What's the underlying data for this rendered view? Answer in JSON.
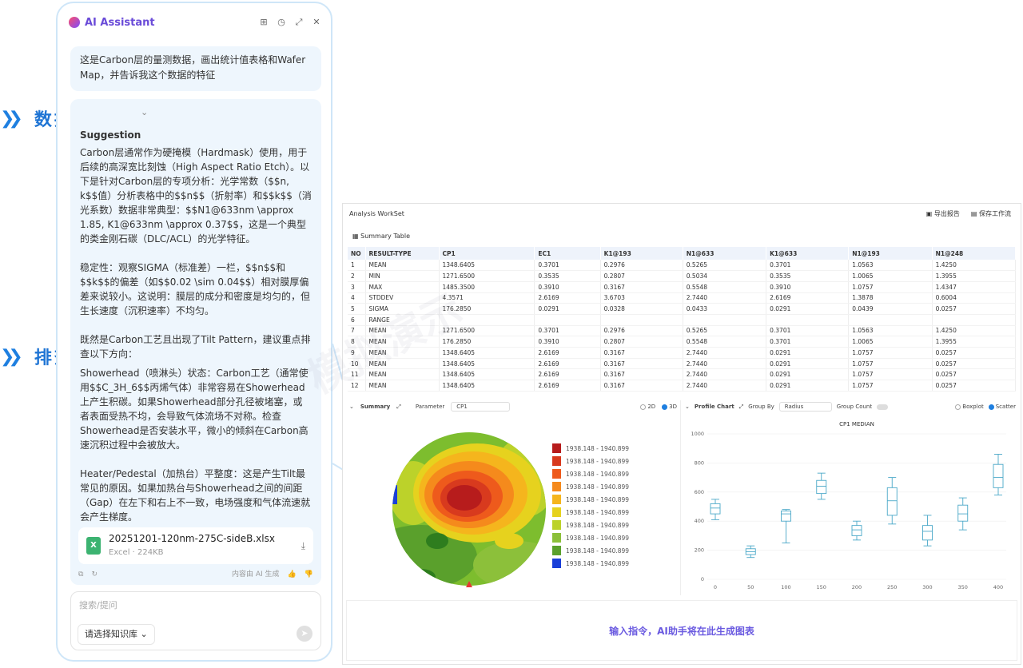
{
  "chat": {
    "brand": "AI Assistant",
    "user_message": "这是Carbon层的量测数据，画出统计值表格和Wafer Map，并告诉我这个数据的特征",
    "suggestion_label": "Suggestion",
    "paragraphs": [
      "Carbon层通常作为硬掩模（Hardmask）使用，用于后续的高深宽比刻蚀（High Aspect Ratio Etch）。以下是针对Carbon层的专项分析：光学常数（$$n, k$$值）分析表格中的$$n$$（折射率）和$$k$$（消光系数）数据非常典型：$$N1@633nm \\approx 1.85, K1@633nm \\approx 0.37$$，这是一个典型的类金刚石碳（DLC/ACL）的光学特征。",
      "稳定性：观察SIGMA（标准差）一栏，$$n$$和$$k$$的偏差（如$$0.02 \\sim 0.04$$）相对膜厚偏差来说较小。这说明：膜层的成分和密度是均匀的，但生长速度（沉积速率）不均匀。",
      "既然是Carbon工艺且出现了Tilt Pattern，建议重点排查以下方向：",
      "Showerhead（喷淋头）状态：Carbon工艺（通常使用$$C_3H_6$$丙烯气体）非常容易在Showerhead上产生积碳。如果Showerhead部分孔径被堵塞，或者表面受热不均，会导致气体流场不对称。检查Showerhead是否安装水平，微小的倾斜在Carbon高速沉积过程中会被放大。",
      "Heater/Pedestal（加热台）平整度：这是产生Tilt最常见的原因。如果加热台与Showerhead之间的间距（Gap）在左下和右上不一致，电场强度和气体流速就会产生梯度。"
    ],
    "file": {
      "name": "20251201-120nm-275C-sideB.xlsx",
      "meta": "Excel · 224KB",
      "badge": "X"
    },
    "foot_note": "内容由 AI 生成",
    "input_placeholder": "搜索/提问",
    "kb_select": "请选择知识库 ⌄"
  },
  "callouts": {
    "first": "数据解读",
    "second": "排查建议"
  },
  "workset": {
    "title": "Analysis WorkSet",
    "export_label": "导出报告",
    "save_label": "保存工作流",
    "table_title": "Summary Table",
    "columns": [
      "NO",
      "RESULT-TYPE",
      "CP1",
      "EC1",
      "K1@193",
      "N1@633",
      "K1@633",
      "N1@193",
      "N1@248"
    ],
    "rows": [
      [
        "1",
        "MEAN",
        "1348.6405",
        "0.3701",
        "0.2976",
        "0.5265",
        "0.3701",
        "1.0563",
        "1.4250"
      ],
      [
        "2",
        "MIN",
        "1271.6500",
        "0.3535",
        "0.2807",
        "0.5034",
        "0.3535",
        "1.0065",
        "1.3955"
      ],
      [
        "3",
        "MAX",
        "1485.3500",
        "0.3910",
        "0.3167",
        "0.5548",
        "0.3910",
        "1.0757",
        "1.4347"
      ],
      [
        "4",
        "STDDEV",
        "4.3571",
        "2.6169",
        "3.6703",
        "2.7440",
        "2.6169",
        "1.3878",
        "0.6004"
      ],
      [
        "5",
        "SIGMA",
        "176.2850",
        "0.0291",
        "0.0328",
        "0.0433",
        "0.0291",
        "0.0439",
        "0.0257"
      ],
      [
        "6",
        "RANGE",
        "",
        "",
        "",
        "",
        "",
        "",
        ""
      ],
      [
        "7",
        "MEAN",
        "1271.6500",
        "0.3701",
        "0.2976",
        "0.5265",
        "0.3701",
        "1.0563",
        "1.4250"
      ],
      [
        "8",
        "MEAN",
        "176.2850",
        "0.3910",
        "0.2807",
        "0.5548",
        "0.3701",
        "1.0065",
        "1.3955"
      ],
      [
        "9",
        "MEAN",
        "1348.6405",
        "2.6169",
        "0.3167",
        "2.7440",
        "0.0291",
        "1.0757",
        "0.0257"
      ],
      [
        "10",
        "MEAN",
        "1348.6405",
        "2.6169",
        "0.3167",
        "2.7440",
        "0.0291",
        "1.0757",
        "0.0257"
      ],
      [
        "11",
        "MEAN",
        "1348.6405",
        "2.6169",
        "0.3167",
        "2.7440",
        "0.0291",
        "1.0757",
        "0.0257"
      ],
      [
        "12",
        "MEAN",
        "1348.6405",
        "2.6169",
        "0.3167",
        "2.7440",
        "0.0291",
        "1.0757",
        "0.0257"
      ]
    ],
    "summary_label": "Summary",
    "parameter_label": "Parameter",
    "parameter_value": "CP1",
    "view_2d": "2D",
    "view_3d": "3D",
    "legend_label": "1938.148 - 1940.899",
    "legend_colors": [
      "#b71c1c",
      "#d83a1e",
      "#ee5a1c",
      "#f58a1c",
      "#f5b51d",
      "#e6d21e",
      "#bcd22a",
      "#8cc03a",
      "#5aa02c",
      "#2e7d1e",
      "#1a3fd8"
    ],
    "profile_label": "Profile Chart",
    "group_by_label": "Group By",
    "group_by_value": "Radius",
    "group_count_label": "Group Count",
    "boxplot_label": "Boxplot",
    "scatter_label": "Scatter",
    "ai_prompt": "输入指令，AI助手将在此生成图表"
  },
  "chart_data": {
    "type": "box",
    "title": "CP1 MEDIAN",
    "xlabel": "",
    "ylabel": "",
    "categories": [
      0,
      50,
      100,
      150,
      200,
      250,
      300,
      350,
      400
    ],
    "ylim": [
      0,
      1000
    ],
    "yticks": [
      0,
      200,
      400,
      600,
      800,
      1000
    ],
    "boxes": [
      {
        "x": 0,
        "min": 410,
        "q1": 450,
        "median": 490,
        "q3": 520,
        "max": 550
      },
      {
        "x": 50,
        "min": 150,
        "q1": 170,
        "median": 190,
        "q3": 210,
        "max": 230
      },
      {
        "x": 100,
        "min": 250,
        "q1": 400,
        "median": 450,
        "q3": 470,
        "max": 480
      },
      {
        "x": 150,
        "min": 550,
        "q1": 590,
        "median": 640,
        "q3": 680,
        "max": 730
      },
      {
        "x": 200,
        "min": 270,
        "q1": 300,
        "median": 340,
        "q3": 370,
        "max": 400
      },
      {
        "x": 250,
        "min": 380,
        "q1": 440,
        "median": 540,
        "q3": 630,
        "max": 700
      },
      {
        "x": 300,
        "min": 230,
        "q1": 270,
        "median": 330,
        "q3": 370,
        "max": 440
      },
      {
        "x": 350,
        "min": 340,
        "q1": 400,
        "median": 450,
        "q3": 510,
        "max": 560
      },
      {
        "x": 400,
        "min": 580,
        "q1": 630,
        "median": 700,
        "q3": 790,
        "max": 860
      }
    ]
  }
}
